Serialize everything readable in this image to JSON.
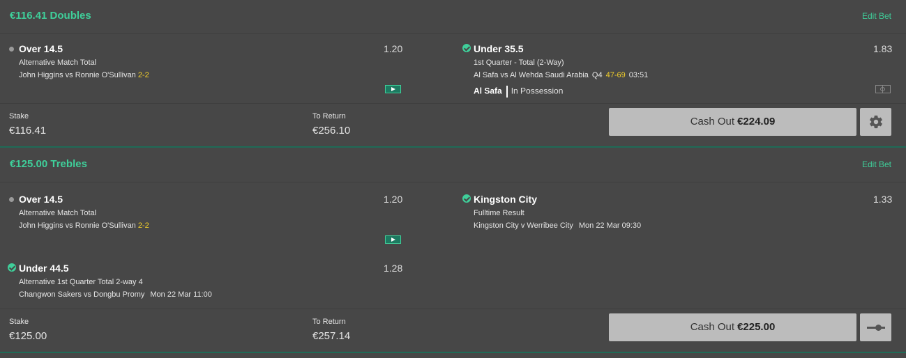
{
  "bets": [
    {
      "title": "€116.41 Doubles",
      "edit_label": "Edit Bet",
      "legs": [
        {
          "status": "pending",
          "selection": "Over 14.5",
          "market": "Alternative Match Total",
          "event": "John Higgins vs Ronnie O'Sullivan",
          "score": "2-2",
          "odds": "1.20",
          "icon": "live-stream-icon"
        },
        {
          "status": "won",
          "selection": "Under 35.5",
          "market": "1st Quarter - Total (2-Way)",
          "event": "Al Safa vs Al Wehda Saudi Arabia",
          "period": "Q4",
          "score": "47-69",
          "clock": "03:51",
          "odds": "1.83",
          "possession_team": "Al Safa",
          "possession_text": "In Possession",
          "icon": "pitch-icon"
        }
      ],
      "stake_label": "Stake",
      "stake": "€116.41",
      "return_label": "To Return",
      "to_return": "€256.10",
      "cashout_label": "Cash Out",
      "cashout_amount": "€224.09",
      "side_icon": "gear-icon"
    },
    {
      "title": "€125.00 Trebles",
      "edit_label": "Edit Bet",
      "legs": [
        {
          "status": "pending",
          "selection": "Over 14.5",
          "market": "Alternative Match Total",
          "event": "John Higgins vs Ronnie O'Sullivan",
          "score": "2-2",
          "odds": "1.20",
          "icon": "live-stream-icon"
        },
        {
          "status": "won",
          "selection": "Kingston City",
          "market": "Fulltime Result",
          "event": "Kingston City v Werribee City",
          "time": "Mon 22 Mar 09:30",
          "odds": "1.33"
        },
        {
          "status": "won",
          "selection": "Under 44.5",
          "market": "Alternative 1st Quarter Total 2-way 4",
          "event": "Changwon Sakers vs Dongbu Promy",
          "time": "Mon 22 Mar 11:00",
          "odds": "1.28"
        }
      ],
      "stake_label": "Stake",
      "stake": "€125.00",
      "return_label": "To Return",
      "to_return": "€257.14",
      "cashout_label": "Cash Out",
      "cashout_amount": "€225.00",
      "side_icon": "cashout-slider-icon"
    }
  ],
  "colors": {
    "accent": "#3fcf9a",
    "score": "#f5d12a",
    "background": "#474747",
    "button": "#bcbcbc"
  }
}
